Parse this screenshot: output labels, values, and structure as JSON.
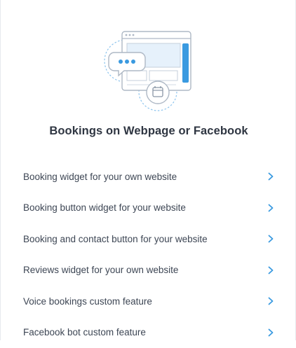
{
  "section": {
    "title": "Bookings on Webpage or Facebook",
    "illustration_icon": "chat-bubble-browser-calendar-icon"
  },
  "menu": {
    "items": [
      {
        "label": "Booking widget for your own website",
        "icon": "chevron-right-icon"
      },
      {
        "label": "Booking button widget for your website",
        "icon": "chevron-right-icon"
      },
      {
        "label": "Booking and contact button for your website",
        "icon": "chevron-right-icon"
      },
      {
        "label": "Reviews widget for your own website",
        "icon": "chevron-right-icon"
      },
      {
        "label": "Voice bookings custom feature",
        "icon": "chevron-right-icon"
      },
      {
        "label": "Facebook bot custom feature",
        "icon": "chevron-right-icon"
      }
    ]
  },
  "colors": {
    "accent": "#3a9ae0",
    "title_text": "#2f3642",
    "item_text": "#3d4654",
    "illustration_line": "#b9c3cf",
    "illustration_fill": "#e8f3fc"
  }
}
